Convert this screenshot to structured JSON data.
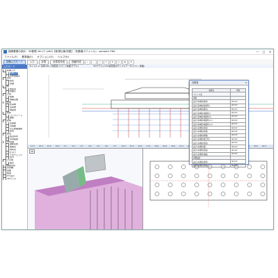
{
  "window": {
    "title": "橋脚基礎の設計・3D配筋 Ver.17 (x64)【新規仕様/改善】- 杭基礎(3ファイル) - sample1.F8A",
    "minimize": "—",
    "maximize": "□",
    "close": "✕"
  },
  "menu": [
    "ファイル(F)",
    "基準値(E)",
    "オプション(O)",
    "ヘルプ(H)"
  ],
  "toolbar": {
    "mode": "初期入力モード",
    "input": "入力",
    "calc": "計算",
    "calc2": "計算書作成",
    "report": "図面作成"
  },
  "sidebar": {
    "header": "入力モード",
    "tree": [
      {
        "label": "初期入力",
        "level": 0
      },
      {
        "label": "初期入力",
        "level": 1,
        "selected": true
      },
      {
        "label": "基準値設定",
        "level": 1
      },
      {
        "label": "形状",
        "level": 0
      },
      {
        "label": "柱形",
        "level": 1
      },
      {
        "label": "基礎",
        "level": 1
      },
      {
        "label": "杭",
        "level": 0
      },
      {
        "label": "杭配置",
        "level": 1
      },
      {
        "label": "杭諸元",
        "level": 1
      },
      {
        "label": "土質",
        "level": 0
      },
      {
        "label": "地層",
        "level": 1
      },
      {
        "label": "地盤定数",
        "level": 1
      },
      {
        "label": "荷重",
        "level": 0
      },
      {
        "label": "死荷重",
        "level": 1
      },
      {
        "label": "活荷重",
        "level": 1
      },
      {
        "label": "地震時",
        "level": 1
      },
      {
        "label": "材料",
        "level": 0
      },
      {
        "label": "コンクリート",
        "level": 1
      },
      {
        "label": "鉄筋",
        "level": 1
      },
      {
        "label": "配筋",
        "level": 0
      },
      {
        "label": "主鉄筋",
        "level": 1
      },
      {
        "label": "帯鉄筋",
        "level": 1
      },
      {
        "label": "せん断補強筋",
        "level": 1
      },
      {
        "label": "配置",
        "level": 1
      },
      {
        "label": "照査",
        "level": 0
      },
      {
        "label": "照査条件",
        "level": 1
      },
      {
        "label": "計算結果",
        "level": 1
      },
      {
        "label": "3D配筋",
        "level": 0
      },
      {
        "label": "鉄筋生成",
        "level": 1
      },
      {
        "label": "鉄筋表",
        "level": 1
      },
      {
        "label": "材料表",
        "level": 1
      },
      {
        "label": "かぶり",
        "level": 1
      },
      {
        "label": "干渉チェック",
        "level": 1
      },
      {
        "label": "出力",
        "level": 1
      },
      {
        "label": "その他",
        "level": 0
      },
      {
        "label": "設定",
        "level": 1
      },
      {
        "label": "構造計算",
        "level": 0
      },
      {
        "label": "計算書",
        "level": 0
      },
      {
        "label": "図面",
        "level": 0
      },
      {
        "label": "数量",
        "level": 0
      },
      {
        "label": "IFC出力",
        "level": 0
      },
      {
        "label": "3Dモデル",
        "level": 0
      }
    ]
  },
  "views": {
    "left_top": "タイトル:2. 基準(3D) / 杭配置(スパン) 断面(モデル)",
    "right_top": "3DモデルとCAD配置図のサンプルデータ(スパン 断面)",
    "bottom_left": "3D"
  },
  "ruler_ticks": [
    "17.5",
    "15.0",
    "12.5",
    "10.0",
    "7.5",
    "5.0",
    "2.5",
    "0.0",
    "2.5",
    "5.0",
    "7.5",
    "10.0",
    "12.5",
    "15.0",
    "17.5",
    "20.0",
    "22.5",
    "25.0",
    "27.5",
    "30.0",
    "32.5",
    "35.0",
    "37.5",
    "40.0",
    "42.5",
    "45.0",
    "47.5",
    "50.0",
    "52.5"
  ],
  "props_panel": {
    "title": "計算書",
    "close": "✕",
    "headers": [
      "項目名",
      "単位"
    ],
    "rows": [
      [
        "ファイル名",
        ""
      ],
      [
        "荷重",
        ""
      ],
      [
        "設計-基本値(使用)",
        "N/mm²"
      ],
      [
        "設計-基本値(使用時)",
        "N/mm²"
      ],
      [
        "設計-基本値(終局)",
        "N/mm²"
      ],
      [
        "設計-基本値(地震時 I)",
        "N/mm²"
      ],
      [
        "設計-基本値(地震時 II)",
        "N/mm²"
      ],
      [
        "設計-基本値(地震時 L1)",
        "N/mm²"
      ],
      [
        "設計-基本値(地震時 L2)",
        "N/mm²"
      ],
      [
        "設計-許容値(永続)",
        "N/mm²"
      ],
      [
        "設計-許容値(変動)",
        "N/mm²"
      ],
      [
        "設計-許容値(偶発)",
        "N/mm²"
      ],
      [
        "設計-許容値(施工時)",
        "N/mm²"
      ],
      [
        "設計-許容値(衝突)",
        "N/mm²"
      ],
      [
        "設計-許容値(風)",
        "N/mm²"
      ],
      [
        "設計-許容値(温度)",
        "N/mm²"
      ],
      [
        "設計-許容値(地震)",
        "N/mm²"
      ],
      [
        "詳細設定",
        ""
      ],
      [
        "設計-許容値(基準)",
        "N/mm²"
      ],
      [
        "設計-許容値(照査)",
        "N/mm²"
      ]
    ]
  },
  "colors": {
    "accent": "#3a6fb6",
    "panel": "#4d79c4"
  }
}
